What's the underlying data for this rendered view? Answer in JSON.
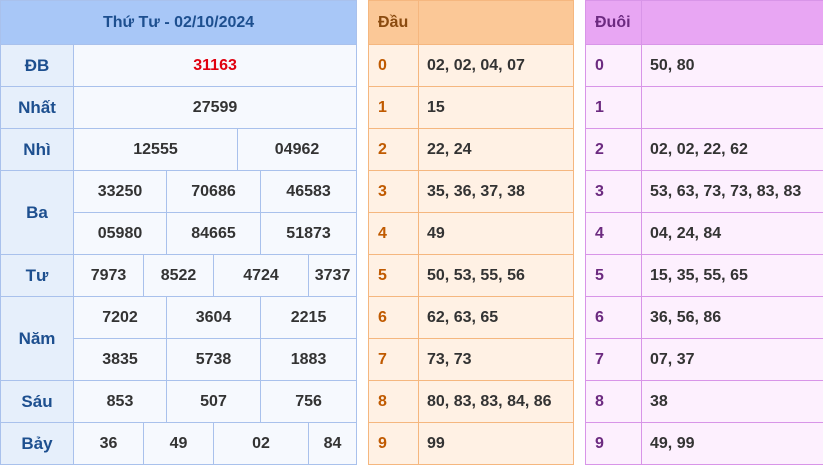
{
  "results": {
    "title": "Thứ Tư - 02/10/2024",
    "rows": {
      "db": {
        "label": "ĐB",
        "values": [
          "31163"
        ]
      },
      "nhat": {
        "label": "Nhất",
        "values": [
          "27599"
        ]
      },
      "nhi": {
        "label": "Nhì",
        "values": [
          "12555",
          "04962"
        ]
      },
      "ba": {
        "label": "Ba",
        "values": [
          "33250",
          "70686",
          "46583",
          "05980",
          "84665",
          "51873"
        ]
      },
      "tu": {
        "label": "Tư",
        "values": [
          "7973",
          "8522",
          "4724",
          "3737"
        ]
      },
      "nam": {
        "label": "Năm",
        "values": [
          "7202",
          "3604",
          "2215",
          "3835",
          "5738",
          "1883"
        ]
      },
      "sau": {
        "label": "Sáu",
        "values": [
          "853",
          "507",
          "756"
        ]
      },
      "bay": {
        "label": "Bảy",
        "values": [
          "36",
          "49",
          "02",
          "84"
        ]
      }
    }
  },
  "head": {
    "title": "Đầu",
    "rows": [
      {
        "digit": "0",
        "values": "02, 02, 04, 07"
      },
      {
        "digit": "1",
        "values": "15"
      },
      {
        "digit": "2",
        "values": "22, 24"
      },
      {
        "digit": "3",
        "values": "35, 36, 37, 38"
      },
      {
        "digit": "4",
        "values": "49"
      },
      {
        "digit": "5",
        "values": "50, 53, 55, 56"
      },
      {
        "digit": "6",
        "values": "62, 63, 65"
      },
      {
        "digit": "7",
        "values": "73, 73"
      },
      {
        "digit": "8",
        "values": "80, 83, 83, 84, 86"
      },
      {
        "digit": "9",
        "values": "99"
      }
    ]
  },
  "tail": {
    "title": "Đuôi",
    "rows": [
      {
        "digit": "0",
        "values": "50, 80"
      },
      {
        "digit": "1",
        "values": ""
      },
      {
        "digit": "2",
        "values": "02, 02, 22, 62"
      },
      {
        "digit": "3",
        "values": "53, 63, 73, 73, 83, 83"
      },
      {
        "digit": "4",
        "values": "04, 24, 84"
      },
      {
        "digit": "5",
        "values": "15, 35, 55, 65"
      },
      {
        "digit": "6",
        "values": "36, 56, 86"
      },
      {
        "digit": "7",
        "values": "07, 37"
      },
      {
        "digit": "8",
        "values": "38"
      },
      {
        "digit": "9",
        "values": "49, 99"
      }
    ]
  },
  "colors": {
    "special_prize": "#e0000f",
    "results_header": "#a8c7f7",
    "head_header": "#fbc897",
    "tail_header": "#e8a6f3"
  }
}
